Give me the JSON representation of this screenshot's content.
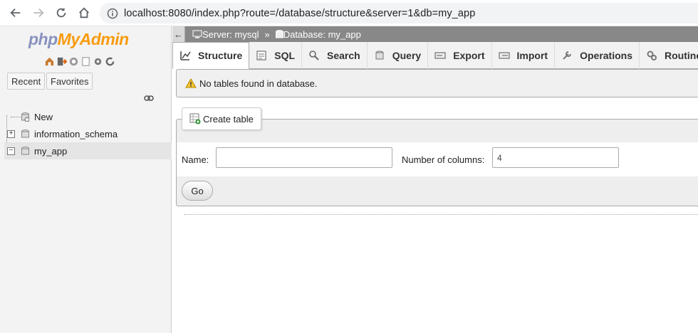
{
  "browser": {
    "url": "localhost:8080/index.php?route=/database/structure&server=1&db=my_app"
  },
  "sidebar": {
    "logo": {
      "php": "php",
      "myadmin": "MyAdmin"
    },
    "quick_icons": [
      "home-icon",
      "logout-icon",
      "help-icon",
      "docs-icon",
      "settings-icon",
      "reload-icon"
    ],
    "tabs": [
      {
        "label": "Recent"
      },
      {
        "label": "Favorites"
      }
    ],
    "tree": [
      {
        "label": "New"
      },
      {
        "label": "information_schema"
      },
      {
        "label": "my_app"
      }
    ]
  },
  "breadcrumb": {
    "server": "Server: mysql",
    "separator": "»",
    "database": "Database: my_app"
  },
  "tabs": [
    {
      "label": "Structure",
      "icon": "structure-icon",
      "active": true
    },
    {
      "label": "SQL",
      "icon": "sql-icon"
    },
    {
      "label": "Search",
      "icon": "search-icon"
    },
    {
      "label": "Query",
      "icon": "query-icon"
    },
    {
      "label": "Export",
      "icon": "export-icon"
    },
    {
      "label": "Import",
      "icon": "import-icon"
    },
    {
      "label": "Operations",
      "icon": "wrench-icon"
    },
    {
      "label": "Routines",
      "icon": "routines-icon"
    }
  ],
  "notice": {
    "text": "No tables found in database."
  },
  "create_table": {
    "legend": "Create table",
    "name_label": "Name:",
    "name_value": "",
    "columns_label": "Number of columns:",
    "columns_value": "4",
    "go_label": "Go"
  }
}
